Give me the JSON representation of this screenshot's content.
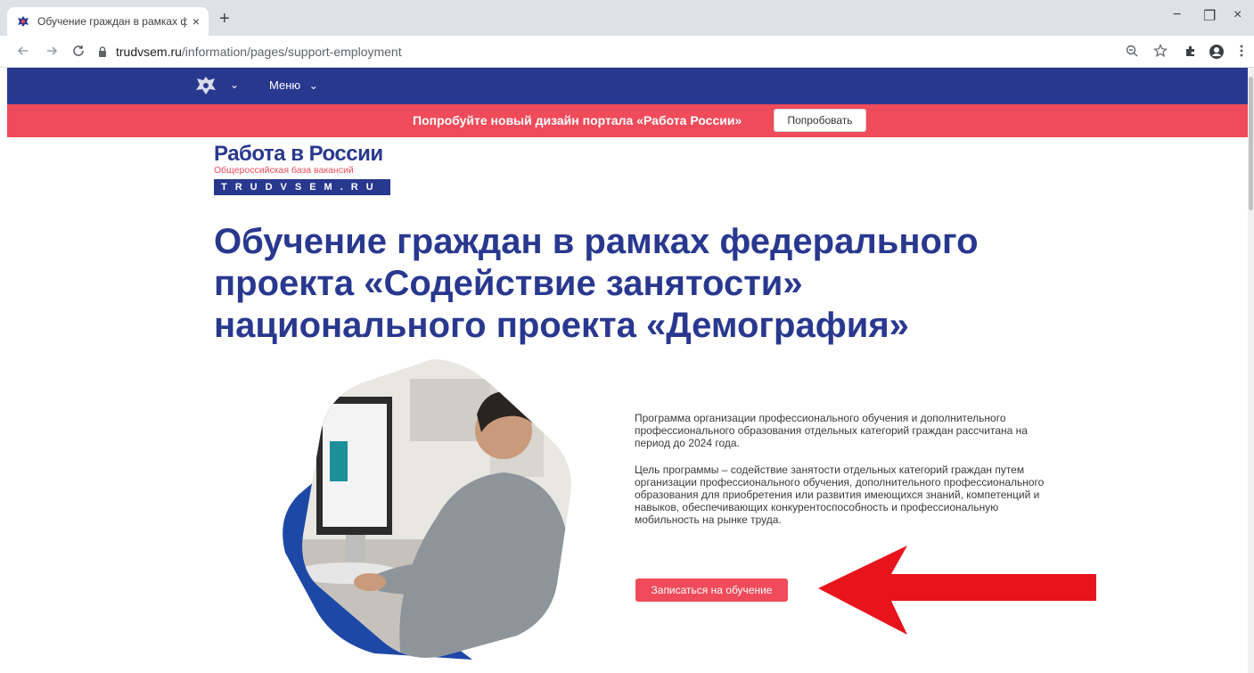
{
  "browser": {
    "tab_title": "Обучение граждан в рамках фе",
    "tab_close": "×",
    "new_tab": "+",
    "url_host": "trudvsem.ru",
    "url_path": "/information/pages/support-employment",
    "window_controls": [
      "−",
      "❐",
      "×"
    ],
    "icons": [
      "back-icon",
      "forward-icon",
      "reload-icon",
      "lock-icon",
      "zoom-icon",
      "star-icon",
      "extensions-icon",
      "profile-icon",
      "kebab-menu-icon"
    ]
  },
  "site_nav": {
    "menu_label": "Меню",
    "chevron": "⌄"
  },
  "promo": {
    "text": "Попробуйте новый дизайн портала «Работа России»",
    "button_label": "Попробовать"
  },
  "logo": {
    "title": "Работа в России",
    "subtitle": "Общероссийская база вакансий",
    "domain": "TRUDVSEM.RU"
  },
  "page": {
    "heading": "Обучение граждан в рамках федерального проекта «Содействие занятости» национального проекта «Демография»",
    "paragraph_1": "Программа организации профессионального обучения и дополнительного профессионального образования отдельных категорий граждан рассчитана на период до 2024 года.",
    "paragraph_2": "Цель программы – содействие занятости отдельных категорий граждан путем организации профессионального обучения, дополнительного профессионального образования для приобретения или развития имеющихся знаний, компетенций и навыков, обеспечивающих конкурентоспособность и профессиональную мобильность на рынке труда.",
    "enroll_button": "Записаться на обучение"
  },
  "colors": {
    "brand_blue": "#29388f",
    "brand_red": "#ef4b5a",
    "annotation_arrow": "#e8141c"
  }
}
